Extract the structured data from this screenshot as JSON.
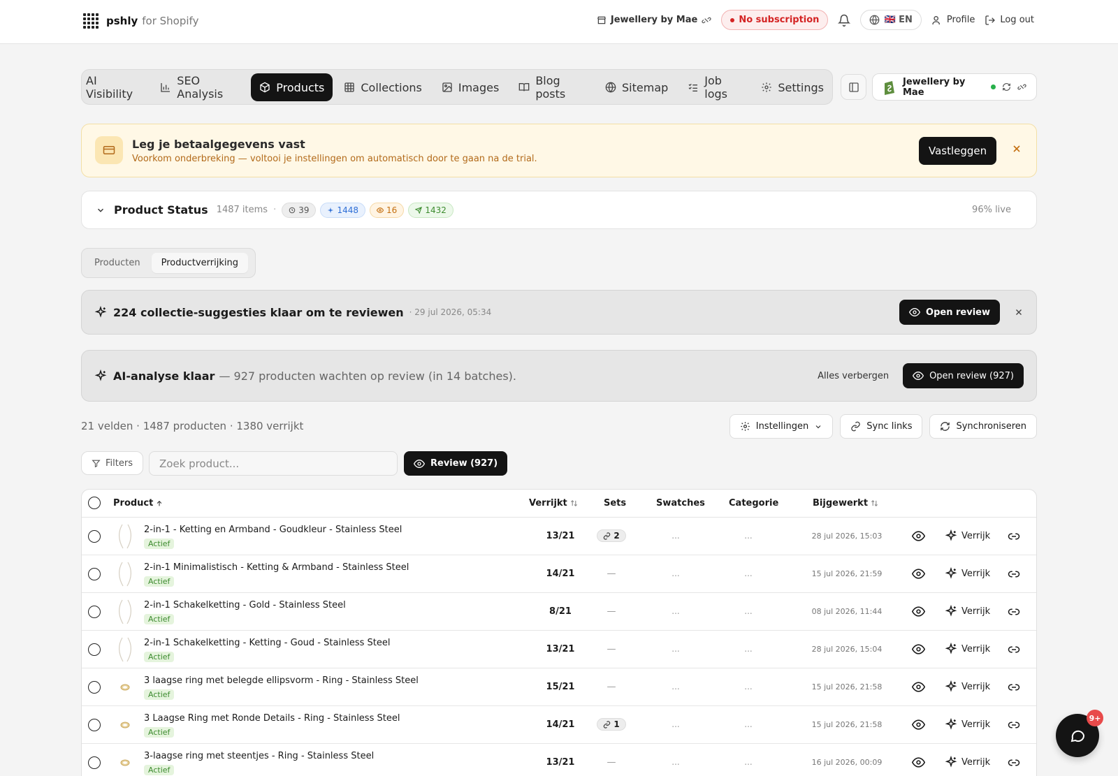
{
  "header": {
    "brand": "pshly",
    "brand_suffix": "for Shopify",
    "store": "Jewellery by Mae",
    "subscription": "No subscription",
    "language": "🇬🇧 EN",
    "profile": "Profile",
    "logout": "Log out"
  },
  "nav": {
    "tabs": [
      {
        "label": "AI Visibility",
        "icon": "eye-off-icon"
      },
      {
        "label": "SEO Analysis",
        "icon": "bar-chart-icon"
      },
      {
        "label": "Products",
        "icon": "box-icon"
      },
      {
        "label": "Collections",
        "icon": "grid-icon"
      },
      {
        "label": "Images",
        "icon": "image-icon"
      },
      {
        "label": "Blog posts",
        "icon": "book-icon"
      },
      {
        "label": "Sitemap",
        "icon": "globe-icon"
      },
      {
        "label": "Job logs",
        "icon": "list-check-icon"
      },
      {
        "label": "Settings",
        "icon": "gear-icon"
      }
    ],
    "active": "Products",
    "store_chip": "Jewellery by Mae"
  },
  "banner": {
    "title": "Leg je betaalgegevens vast",
    "subtitle": "Voorkom onderbreking — voltooi je instellingen om automatisch door te gaan na de trial.",
    "button": "Vastleggen"
  },
  "product_status": {
    "title": "Product Status",
    "count": "1487 items",
    "badges": [
      "39",
      "1448",
      "16",
      "1432"
    ],
    "live": "96% live"
  },
  "segments": {
    "items": [
      "Producten",
      "Productverrijking"
    ],
    "active": "Productverrijking"
  },
  "notice1": {
    "title": "224 collectie-suggesties klaar om te reviewen",
    "date": "· 29 jul 2026, 05:34",
    "button": "Open review"
  },
  "notice2": {
    "title": "AI-analyse klaar",
    "rest": "— 927 producten wachten op review (in 14 batches).",
    "hide": "Alles verbergen",
    "button": "Open review (927)"
  },
  "summary": "21 velden · 1487 producten · 1380 verrijkt",
  "actions": {
    "settings": "Instellingen",
    "sync_links": "Sync links",
    "sync": "Synchroniseren"
  },
  "toolbar": {
    "filters": "Filters",
    "search_placeholder": "Zoek product...",
    "review": "Review (927)"
  },
  "table": {
    "headers": {
      "product": "Product",
      "verrijkt": "Verrijkt",
      "sets": "Sets",
      "swatches": "Swatches",
      "categorie": "Categorie",
      "bijgewerkt": "Bijgewerkt"
    },
    "action_label": "Verrijk",
    "status_label": "Actief",
    "rows": [
      {
        "name": "2-in-1 - Ketting en Armband - Goudkleur - Stainless Steel",
        "verrijkt": "13/21",
        "sets": "2",
        "swatches": "...",
        "categorie": "...",
        "date": "28 jul 2026, 15:03",
        "thumb": "necklace"
      },
      {
        "name": "2-in-1 Minimalistisch - Ketting & Armband - Stainless Steel",
        "verrijkt": "14/21",
        "sets": "—",
        "swatches": "...",
        "categorie": "...",
        "date": "15 jul 2026, 21:59",
        "thumb": "necklace"
      },
      {
        "name": "2-in-1 Schakelketting - Gold - Stainless Steel",
        "verrijkt": "8/21",
        "sets": "—",
        "swatches": "...",
        "categorie": "...",
        "date": "08 jul 2026, 11:44",
        "thumb": "necklace"
      },
      {
        "name": "2-in-1 Schakelketting - Ketting - Goud - Stainless Steel",
        "verrijkt": "13/21",
        "sets": "—",
        "swatches": "...",
        "categorie": "...",
        "date": "28 jul 2026, 15:04",
        "thumb": "necklace"
      },
      {
        "name": "3 laagse ring met belegde ellipsvorm - Ring - Stainless Steel",
        "verrijkt": "15/21",
        "sets": "—",
        "swatches": "...",
        "categorie": "...",
        "date": "15 jul 2026, 21:58",
        "thumb": "ring"
      },
      {
        "name": "3 Laagse Ring met Ronde Details - Ring - Stainless Steel",
        "verrijkt": "14/21",
        "sets": "1",
        "swatches": "...",
        "categorie": "...",
        "date": "15 jul 2026, 21:58",
        "thumb": "ring"
      },
      {
        "name": "3-laagse ring met steentjes - Ring - Stainless Steel",
        "verrijkt": "13/21",
        "sets": "—",
        "swatches": "...",
        "categorie": "...",
        "date": "16 jul 2026, 00:09",
        "thumb": "ring"
      }
    ]
  },
  "chat": {
    "badge": "9+"
  },
  "colors": {
    "accent": "#141414",
    "danger": "#d42424",
    "warning_bg": "#fff8e6",
    "success": "#3d8b2f"
  }
}
